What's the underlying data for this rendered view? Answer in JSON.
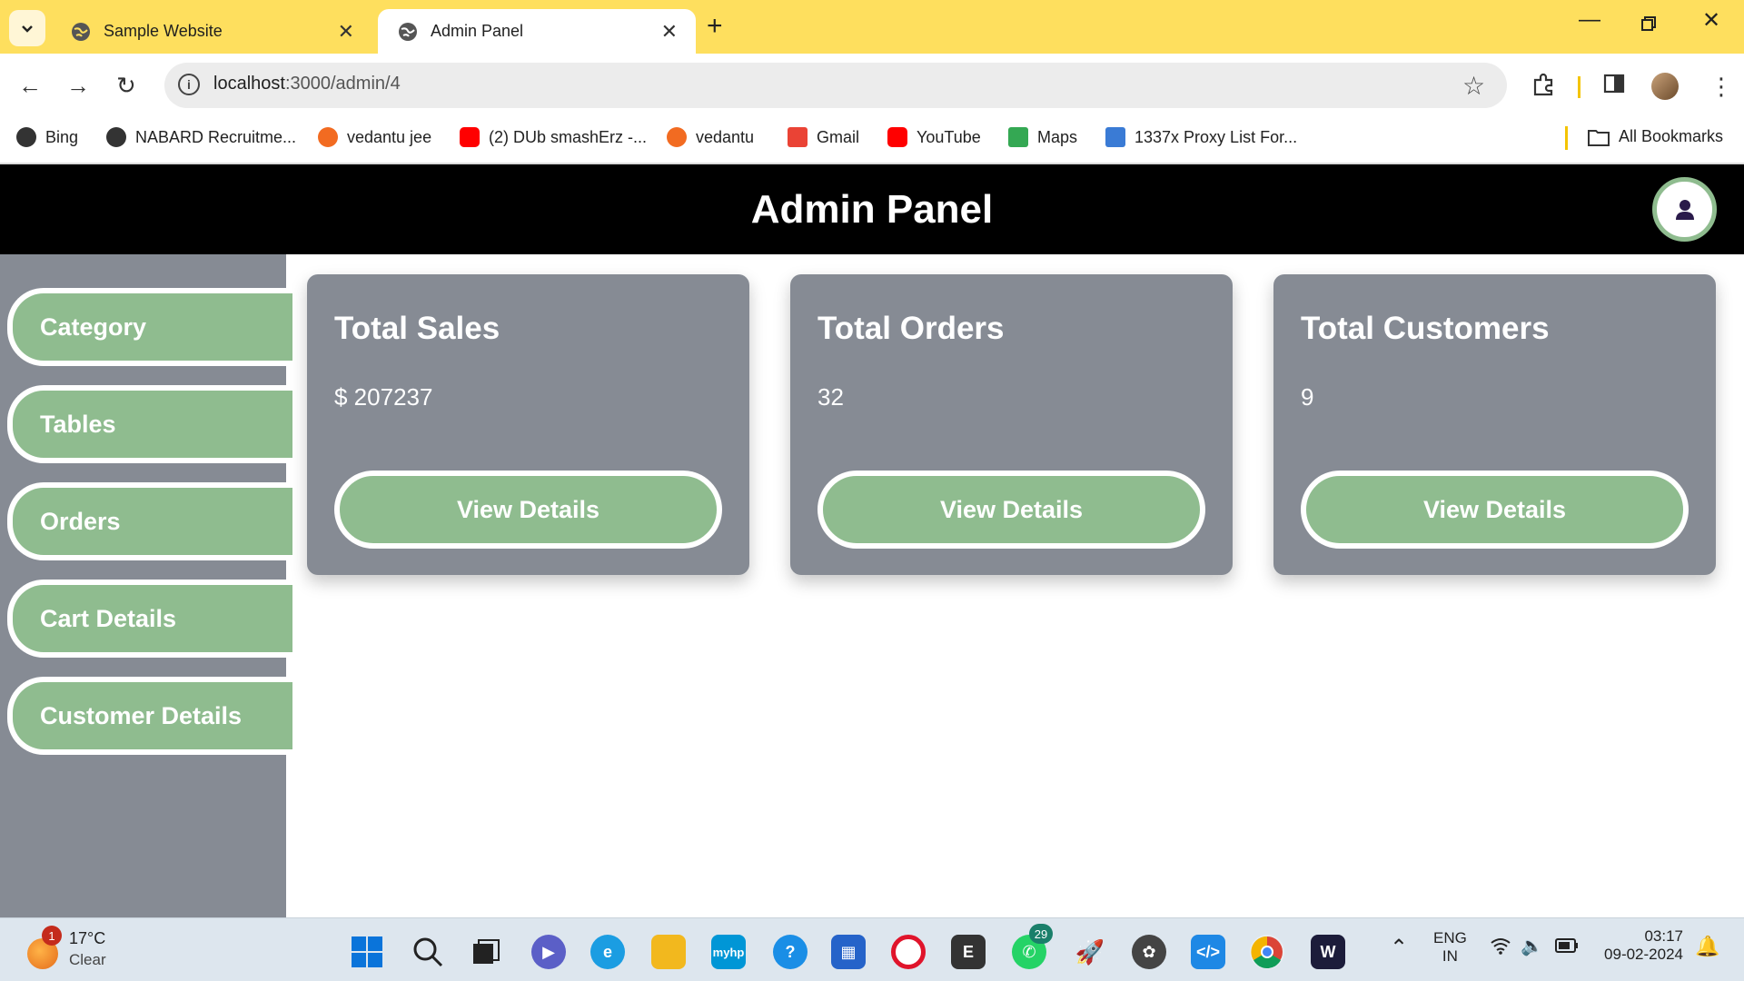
{
  "browser": {
    "tabs": [
      {
        "title": "Sample Website",
        "active": false
      },
      {
        "title": "Admin Panel",
        "active": true
      }
    ],
    "url_host": "localhost",
    "url_path": ":3000/admin/4",
    "bookmarks": [
      {
        "label": "Bing",
        "icon": "globe-icon",
        "color": "#333333"
      },
      {
        "label": "NABARD Recruitme...",
        "icon": "globe-icon",
        "color": "#333333"
      },
      {
        "label": "vedantu jee",
        "icon": "vedantu-icon",
        "color": "#f26b21"
      },
      {
        "label": "(2) DUb smashErz -...",
        "icon": "youtube-icon",
        "color": "#ff0000"
      },
      {
        "label": "vedantu",
        "icon": "vedantu-icon",
        "color": "#f26b21"
      },
      {
        "label": "Gmail",
        "icon": "gmail-icon",
        "color": "#ea4335"
      },
      {
        "label": "YouTube",
        "icon": "youtube-icon",
        "color": "#ff0000"
      },
      {
        "label": "Maps",
        "icon": "maps-icon",
        "color": "#34a853"
      },
      {
        "label": "1337x Proxy List For...",
        "icon": "proxy-icon",
        "color": "#3a7bd5"
      }
    ],
    "all_bookmarks_label": "All Bookmarks"
  },
  "page": {
    "title": "Admin Panel",
    "accent_color": "#8fbc8f",
    "panel_color": "#868b94",
    "sidebar": [
      {
        "label": "Category"
      },
      {
        "label": "Tables"
      },
      {
        "label": "Orders"
      },
      {
        "label": "Cart Details"
      },
      {
        "label": "Customer Details"
      }
    ],
    "cards": [
      {
        "title": "Total Sales",
        "value": "$ 207237",
        "button": "View Details"
      },
      {
        "title": "Total Orders",
        "value": "32",
        "button": "View Details"
      },
      {
        "title": "Total Customers",
        "value": "9",
        "button": "View Details"
      }
    ]
  },
  "taskbar": {
    "weather_badge": "1",
    "temperature": "17°C",
    "condition": "Clear",
    "whatsapp_badge": "29",
    "language": "ENG",
    "region": "IN",
    "time": "03:17",
    "date": "09-02-2024"
  }
}
